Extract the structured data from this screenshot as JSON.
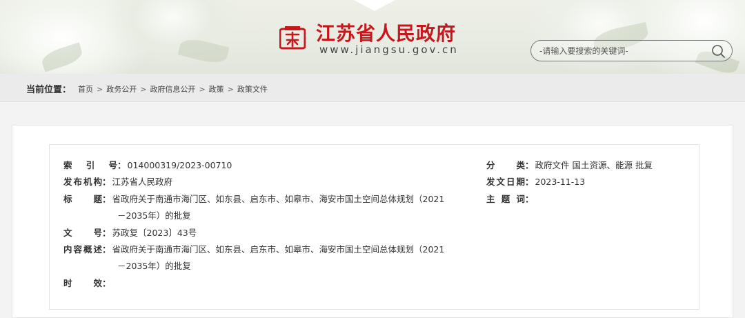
{
  "header": {
    "title": "江苏省人民政府",
    "url": "www.jiangsu.gov.cn",
    "search_placeholder": "-请输入要搜索的关键词-",
    "brand_color": "#c8161d"
  },
  "breadcrumb": {
    "label": "当前位置：",
    "items": [
      "首页",
      "政务公开",
      "政府信息公开",
      "政策",
      "政策文件"
    ],
    "separator": ">"
  },
  "meta": {
    "index_no": {
      "label": "索 引 号",
      "value": "014000319/2023-00710"
    },
    "category": {
      "label": "分 类",
      "value": "政府文件 国土资源、能源 批复"
    },
    "issuer": {
      "label": "发布机构",
      "value": "江苏省人民政府"
    },
    "issue_date": {
      "label": "发文日期",
      "value": "2023-11-13"
    },
    "title": {
      "label": "标 题",
      "line1": "省政府关于南通市海门区、如东县、启东市、如皋市、海安市国土空间总体规划（2021",
      "line2": "－2035年）的批复"
    },
    "subject": {
      "label": "主 题 词",
      "value": ""
    },
    "doc_no": {
      "label": "文 号",
      "value": "苏政复〔2023〕43号"
    },
    "summary": {
      "label": "内容概述",
      "line1": "省政府关于南通市海门区、如东县、启东市、如皋市、海安市国土空间总体规划（2021",
      "line2": "－2035年）的批复"
    },
    "validity": {
      "label": "时 效",
      "value": ""
    }
  }
}
